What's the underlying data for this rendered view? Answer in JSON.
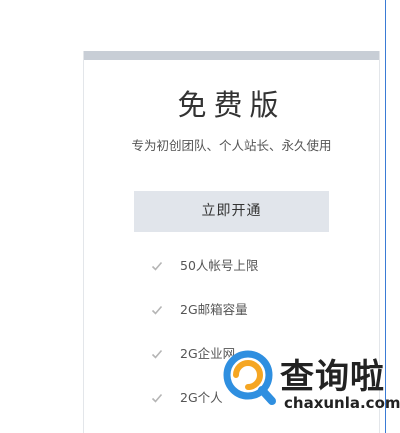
{
  "plan": {
    "title": "免费版",
    "subtitle": "专为初创团队、个人站长、永久使用",
    "open_button_label": "立即开通",
    "features": [
      {
        "text": "50人帐号上限",
        "icon": "check-icon"
      },
      {
        "text": "2G邮箱容量",
        "icon": "check-icon"
      },
      {
        "text": "2G企业网",
        "icon": "check-icon"
      },
      {
        "text": "2G个人",
        "icon": "check-icon"
      }
    ]
  },
  "watermark": {
    "name": "查询啦",
    "domain": "chaxunla.com"
  },
  "colors": {
    "card_topbar": "#c8ced6",
    "button_bg": "#e1e5eb",
    "check": "#b5b5b5",
    "logo_orange": "#f5a623",
    "logo_blue": "#2f8fe0",
    "edge_line": "#3a7bd5"
  }
}
